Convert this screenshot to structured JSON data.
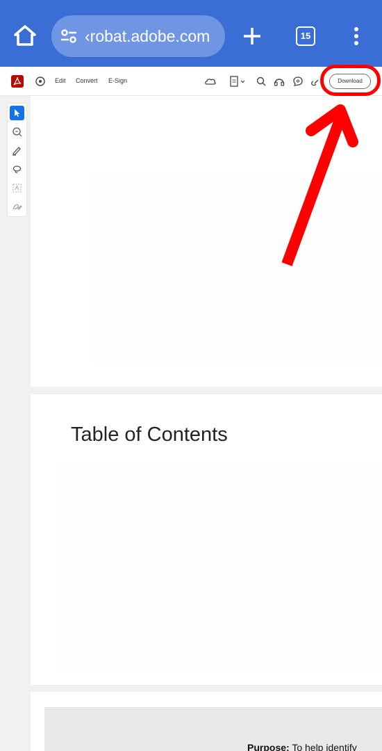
{
  "browser": {
    "url": "‹robat.adobe.com",
    "tab_count": "15"
  },
  "toolbar": {
    "edit_label": "Edit",
    "convert_label": "Convert",
    "esign_label": "E-Sign",
    "download_label": "Download"
  },
  "document": {
    "toc_title": "Table of Contents",
    "purpose_label": "Purpose:",
    "purpose_text": " To help identify"
  },
  "colors": {
    "browser_bar": "#3a6ed5",
    "highlight": "#ff0000",
    "acrobat_brand": "#b30b00",
    "tool_active": "#1473e6"
  },
  "icons": [
    "home-icon",
    "site-settings-icon",
    "plus-icon",
    "tabs-icon",
    "more-vert-icon",
    "acrobat-logo-icon",
    "ai-assistant-icon",
    "cloud-icon",
    "page-icon",
    "search-icon",
    "headphones-icon",
    "comment-icon",
    "link-icon",
    "select-icon",
    "comment-tool-icon",
    "draw-icon",
    "lasso-icon",
    "text-select-icon",
    "sign-icon"
  ]
}
